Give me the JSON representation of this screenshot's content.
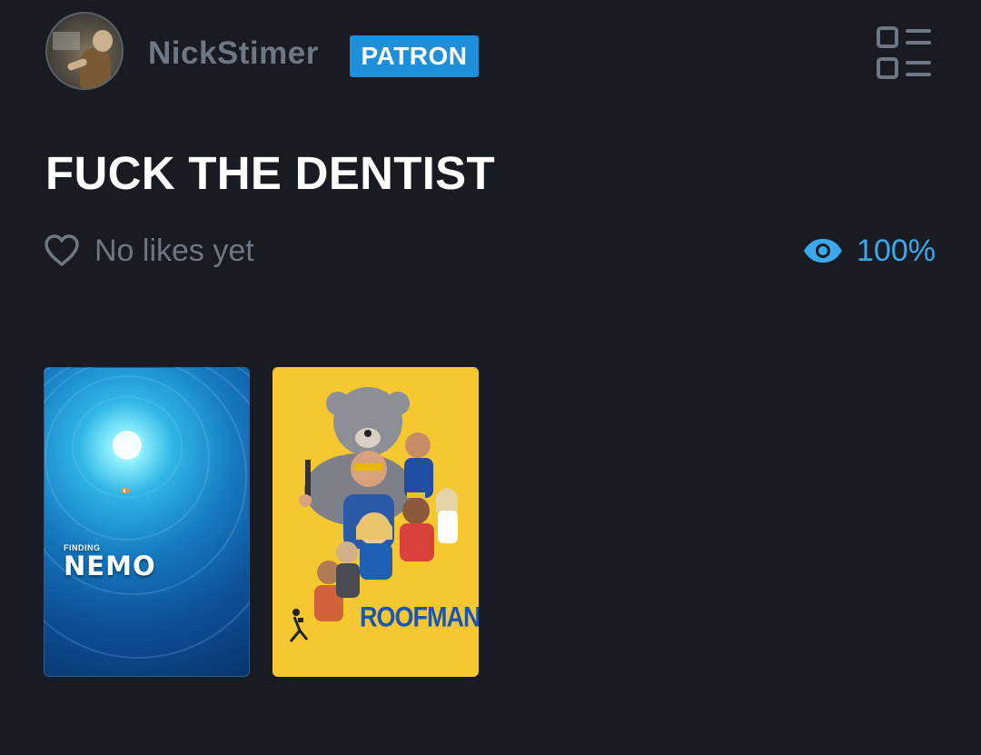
{
  "header": {
    "username": "NickStimer",
    "badge": "PATRON",
    "menu_icon": "list-view-icon"
  },
  "post": {
    "title": "FUCK THE DENTIST",
    "likes_text": "No likes yet",
    "watched_percent": "100%"
  },
  "posters": [
    {
      "logo_small": "FINDING",
      "logo_big": "NEMO"
    },
    {
      "logo": "ROOFMAN"
    }
  ],
  "colors": {
    "background": "#181b21",
    "badge": "#1e8fd8",
    "accent": "#3ea7ea",
    "muted_text": "#6e7784"
  }
}
